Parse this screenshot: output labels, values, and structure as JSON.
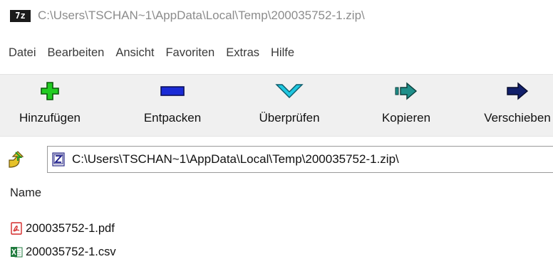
{
  "window": {
    "app_icon_text": "7z",
    "title": "C:\\Users\\TSCHAN~1\\AppData\\Local\\Temp\\200035752-1.zip\\"
  },
  "menu": {
    "items": [
      "Datei",
      "Bearbeiten",
      "Ansicht",
      "Favoriten",
      "Extras",
      "Hilfe"
    ]
  },
  "toolbar": {
    "add": "Hinzufügen",
    "extract": "Entpacken",
    "test": "Überprüfen",
    "copy": "Kopieren",
    "move": "Verschieben"
  },
  "address": {
    "path": "C:\\Users\\TSCHAN~1\\AppData\\Local\\Temp\\200035752-1.zip\\"
  },
  "filelist": {
    "column_name": "Name",
    "files": [
      {
        "name": "200035752-1.pdf",
        "icon": "pdf-file-icon"
      },
      {
        "name": "200035752-1.csv",
        "icon": "excel-file-icon"
      }
    ]
  },
  "colors": {
    "add_green": "#22cc22",
    "extract_blue": "#1a2bd6",
    "test_cyan": "#1fc7e0",
    "copy_teal": "#1f8f8a",
    "move_navy": "#12206b",
    "pdf_red": "#d42a2a",
    "excel_green": "#1e7a3c"
  }
}
